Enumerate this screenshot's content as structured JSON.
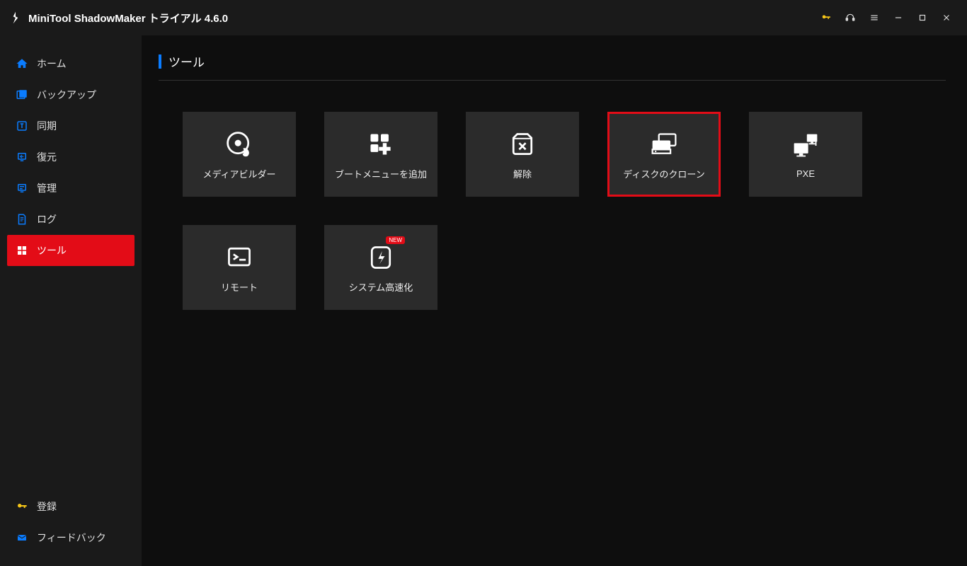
{
  "titlebar": {
    "appName": "MiniTool ShadowMaker",
    "edition": "トライアル",
    "version": "4.6.0"
  },
  "sidebar": {
    "items": [
      {
        "label": "ホーム"
      },
      {
        "label": "バックアップ"
      },
      {
        "label": "同期"
      },
      {
        "label": "復元"
      },
      {
        "label": "管理"
      },
      {
        "label": "ログ"
      },
      {
        "label": "ツール"
      }
    ],
    "bottom": [
      {
        "label": "登録"
      },
      {
        "label": "フィードバック"
      }
    ]
  },
  "page": {
    "title": "ツール"
  },
  "tools": [
    {
      "label": "メディアビルダー"
    },
    {
      "label": "ブートメニューを追加"
    },
    {
      "label": "解除"
    },
    {
      "label": "ディスクのクローン"
    },
    {
      "label": "PXE"
    },
    {
      "label": "リモート"
    },
    {
      "label": "システム高速化",
      "badge": "NEW"
    }
  ],
  "colors": {
    "accent": "#e30c17",
    "blue": "#0a7cff",
    "tile": "#2b2b2b"
  }
}
